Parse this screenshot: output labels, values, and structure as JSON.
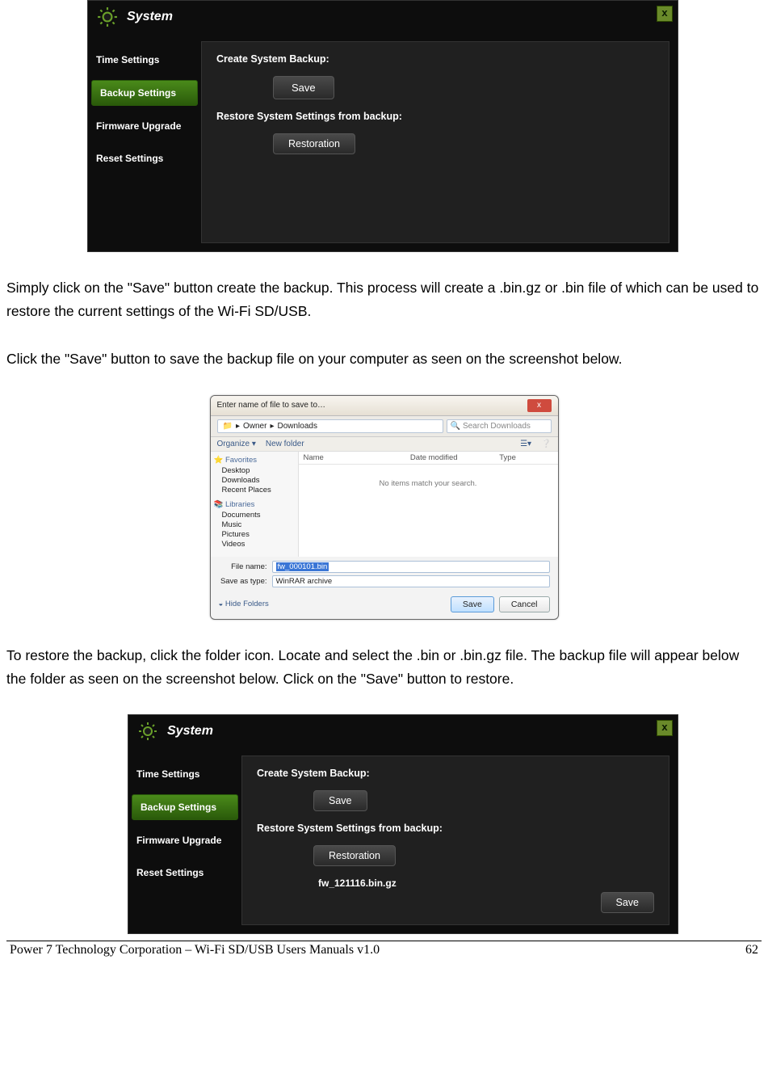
{
  "sys_panel": {
    "title": "System",
    "close": "x",
    "nav": [
      "Time Settings",
      "Backup Settings",
      "Firmware Upgrade",
      "Reset Settings"
    ],
    "active_index": 1,
    "create_label": "Create System Backup:",
    "save_btn": "Save",
    "restore_label": "Restore System Settings from backup:",
    "restoration_btn": "Restoration",
    "restore_file": "fw_121116.bin.gz",
    "bottom_save": "Save"
  },
  "paragraphs": {
    "p1": "Simply click on the \"Save\" button create the backup.   This process will create a .bin.gz or .bin file of which can be used to restore the current settings of the Wi-Fi SD/USB.",
    "p2": "Click the \"Save\" button to save the backup file on your computer as seen on the screenshot below.",
    "p3": "To restore the backup, click the folder icon.   Locate and select the .bin or .bin.gz file.   The backup file will appear below the folder as seen on the screenshot below.   Click on the \"Save\" button to restore."
  },
  "save_dialog": {
    "title": "Enter name of file to save to…",
    "close": "x",
    "path_parts": [
      "Owner",
      "Downloads"
    ],
    "search_placeholder": "Search Downloads",
    "toolbar": {
      "organize": "Organize ▾",
      "new_folder": "New folder"
    },
    "tree": {
      "favorites": "Favorites",
      "fav_items": [
        "Desktop",
        "Downloads",
        "Recent Places"
      ],
      "libraries": "Libraries",
      "lib_items": [
        "Documents",
        "Music",
        "Pictures",
        "Videos"
      ]
    },
    "columns": [
      "Name",
      "Date modified",
      "Type"
    ],
    "empty": "No items match your search.",
    "file_name_label": "File name:",
    "file_name_value": "fw_000101.bin",
    "save_type_label": "Save as type:",
    "save_type_value": "WinRAR archive",
    "hide_folders": "Hide Folders",
    "save_btn": "Save",
    "cancel_btn": "Cancel"
  },
  "footer": {
    "left": "Power 7 Technology Corporation – Wi-Fi SD/USB Users Manuals v1.0",
    "right": "62"
  }
}
